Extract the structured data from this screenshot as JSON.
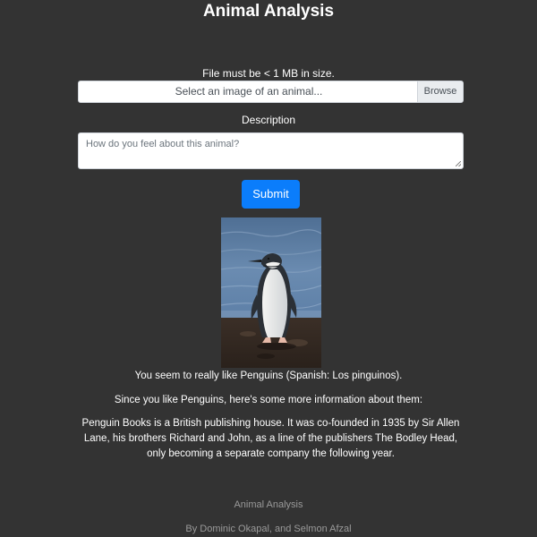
{
  "header": {
    "title": "Animal Analysis"
  },
  "upload": {
    "note": "File must be < 1 MB in size.",
    "placeholder": "Select an image of an animal...",
    "browse_label": "Browse"
  },
  "description": {
    "label": "Description",
    "placeholder": "How do you feel about this animal?"
  },
  "form": {
    "submit_label": "Submit"
  },
  "result": {
    "image_icon": "penguin-photo",
    "summary": "You seem to really like Penguins (Spanish: Los pinguinos).",
    "intro": "Since you like Penguins, here's some more information about them:",
    "info": "Penguin Books is a British publishing house. It was co-founded in 1935 by Sir Allen Lane, his brothers Richard and John, as a line of the publishers The Bodley Head, only becoming a separate company the following year."
  },
  "footer": {
    "app_name": "Animal Analysis",
    "credits": "By Dominic Okapal, and Selmon Afzal"
  },
  "colors": {
    "background": "#333333",
    "primary_button": "#0b7dfb",
    "footer_text": "#9a9a9a"
  }
}
